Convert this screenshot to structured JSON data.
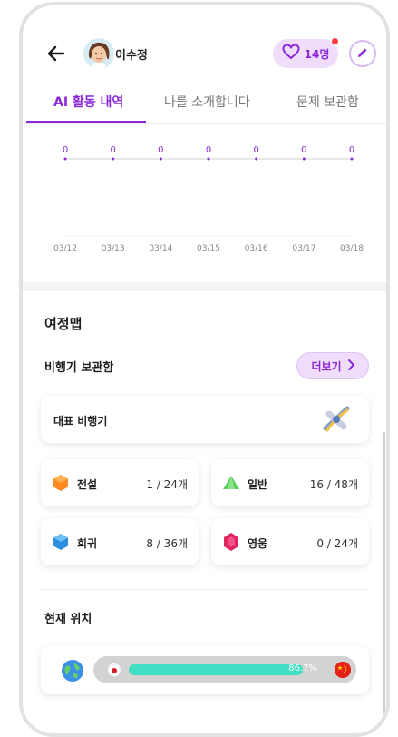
{
  "header": {
    "user_name": "이수정",
    "like_count": "14명"
  },
  "tabs": [
    {
      "label": "AI 활동 내역",
      "active": true
    },
    {
      "label": "나를 소개합니다",
      "active": false
    },
    {
      "label": "문제 보관함",
      "active": false
    }
  ],
  "chart_data": {
    "type": "line",
    "categories": [
      "03/12",
      "03/13",
      "03/14",
      "03/15",
      "03/16",
      "03/17",
      "03/18"
    ],
    "values": [
      0,
      0,
      0,
      0,
      0,
      0,
      0
    ],
    "data_labels": [
      "0",
      "0",
      "0",
      "0",
      "0",
      "0",
      "0"
    ],
    "series_color": "#8a28d8"
  },
  "journey": {
    "title": "여정맵",
    "hangar_title": "비행기 보관함",
    "more_label": "더보기",
    "representative_label": "대표 비행기",
    "grades": [
      {
        "name": "전설",
        "value": "1 / 24개",
        "color": "#ff8a1f",
        "icon": "orange-hexagon-gem-icon"
      },
      {
        "name": "일반",
        "value": "16 / 48개",
        "color": "#5ccf5c",
        "icon": "green-triangle-gem-icon"
      },
      {
        "name": "희귀",
        "value": "8 / 36개",
        "color": "#2b8fe0",
        "icon": "blue-hexagon-gem-icon"
      },
      {
        "name": "영웅",
        "value": "0 / 24개",
        "color": "#e0245e",
        "icon": "red-gem-icon"
      }
    ]
  },
  "location": {
    "title": "현재 위치",
    "progress_percent": 86.7,
    "progress_label": "86.7%",
    "accent": "#40dfc4"
  }
}
